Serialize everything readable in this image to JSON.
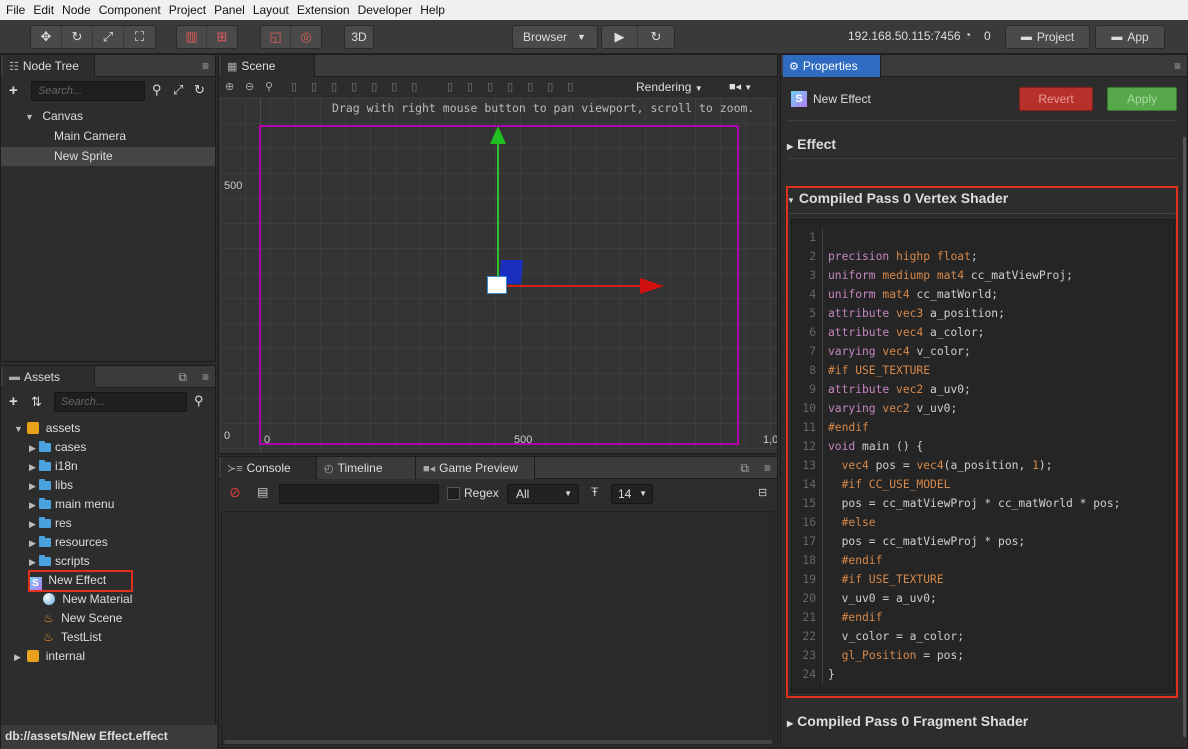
{
  "menubar": {
    "items": [
      "File",
      "Edit",
      "Node",
      "Component",
      "Project",
      "Panel",
      "Layout",
      "Extension",
      "Developer",
      "Help"
    ]
  },
  "toolbar": {
    "browser_label": "Browser",
    "mode_3d": "3D",
    "ip": "192.168.50.115:7456",
    "wifi_count": "0",
    "project_button": "Project",
    "app_button": "App"
  },
  "node_tree": {
    "tab": "Node Tree",
    "search_placeholder": "Search...",
    "items": [
      {
        "label": "Canvas"
      },
      {
        "label": "Main Camera"
      },
      {
        "label": "New Sprite"
      }
    ]
  },
  "assets": {
    "tab": "Assets",
    "search_placeholder": "Search...",
    "root": "assets",
    "folders": [
      "cases",
      "i18n",
      "libs",
      "main menu",
      "res",
      "resources",
      "scripts"
    ],
    "files": [
      "New Effect",
      "New Material",
      "New Scene",
      "TestList"
    ],
    "internal": "internal",
    "status_path": "db://assets/New Effect.effect"
  },
  "scene": {
    "tab": "Scene",
    "hint": "Drag with right mouse button to pan viewport, scroll to zoom.",
    "rendering_label": "Rendering",
    "ruler_y_500": "500",
    "ruler_y_0": "0",
    "ruler_x_0": "0",
    "ruler_x_500": "500",
    "ruler_x_1000": "1,0"
  },
  "console": {
    "tabs": [
      "Console",
      "Timeline",
      "Game Preview"
    ],
    "regex_label": "Regex",
    "filter_value": "All",
    "font_size": "14"
  },
  "properties": {
    "tab": "Properties",
    "asset_name": "New Effect",
    "revert_label": "Revert",
    "apply_label": "Apply",
    "section_effect": "Effect",
    "section_vertex": "Compiled Pass 0 Vertex Shader",
    "section_fragment": "Compiled Pass 0 Fragment Shader",
    "code_lines": [
      "",
      "precision highp float;",
      "uniform mediump mat4 cc_matViewProj;",
      "uniform mat4 cc_matWorld;",
      "attribute vec3 a_position;",
      "attribute vec4 a_color;",
      "varying vec4 v_color;",
      "#if USE_TEXTURE",
      "attribute vec2 a_uv0;",
      "varying vec2 v_uv0;",
      "#endif",
      "void main () {",
      "  vec4 pos = vec4(a_position, 1);",
      "  #if CC_USE_MODEL",
      "  pos = cc_matViewProj * cc_matWorld * pos;",
      "  #else",
      "  pos = cc_matViewProj * pos;",
      "  #endif",
      "  #if USE_TEXTURE",
      "  v_uv0 = a_uv0;",
      "  #endif",
      "  v_color = a_color;",
      "  gl_Position = pos;",
      "}"
    ]
  },
  "colors": {
    "accent_tab": "#2f6bc0",
    "revert": "#c0392b",
    "apply": "#5cb85c",
    "highlight": "#e0301e"
  }
}
